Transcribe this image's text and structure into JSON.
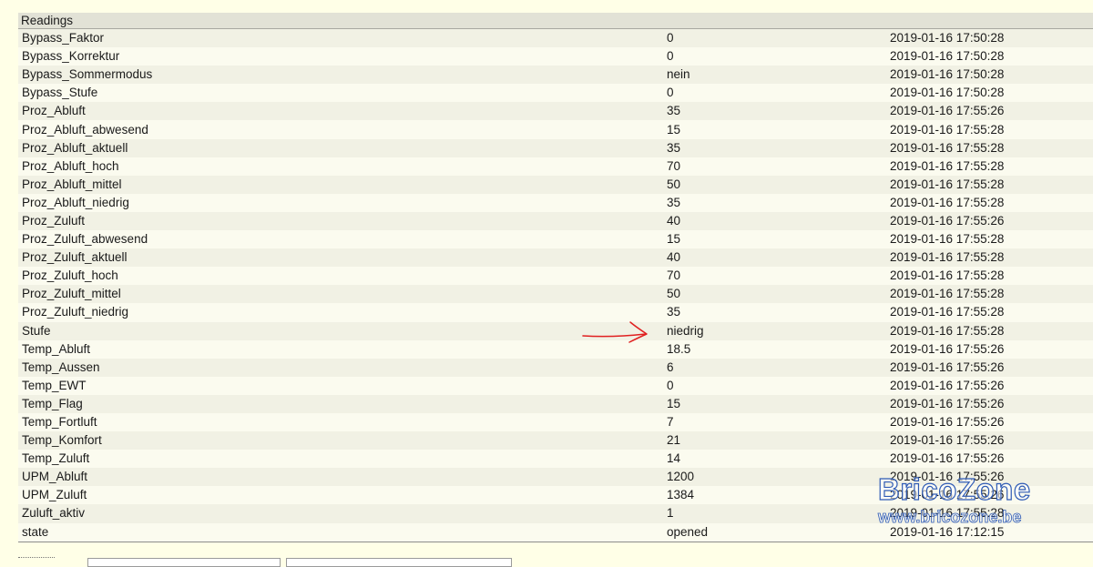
{
  "section": {
    "title": "Readings"
  },
  "readings": [
    {
      "name": "Bypass_Faktor",
      "value": "0",
      "timestamp": "2019-01-16 17:50:28"
    },
    {
      "name": "Bypass_Korrektur",
      "value": "0",
      "timestamp": "2019-01-16 17:50:28"
    },
    {
      "name": "Bypass_Sommermodus",
      "value": "nein",
      "timestamp": "2019-01-16 17:50:28"
    },
    {
      "name": "Bypass_Stufe",
      "value": "0",
      "timestamp": "2019-01-16 17:50:28"
    },
    {
      "name": "Proz_Abluft",
      "value": "35",
      "timestamp": "2019-01-16 17:55:26"
    },
    {
      "name": "Proz_Abluft_abwesend",
      "value": "15",
      "timestamp": "2019-01-16 17:55:28"
    },
    {
      "name": "Proz_Abluft_aktuell",
      "value": "35",
      "timestamp": "2019-01-16 17:55:28"
    },
    {
      "name": "Proz_Abluft_hoch",
      "value": "70",
      "timestamp": "2019-01-16 17:55:28"
    },
    {
      "name": "Proz_Abluft_mittel",
      "value": "50",
      "timestamp": "2019-01-16 17:55:28"
    },
    {
      "name": "Proz_Abluft_niedrig",
      "value": "35",
      "timestamp": "2019-01-16 17:55:28"
    },
    {
      "name": "Proz_Zuluft",
      "value": "40",
      "timestamp": "2019-01-16 17:55:26"
    },
    {
      "name": "Proz_Zuluft_abwesend",
      "value": "15",
      "timestamp": "2019-01-16 17:55:28"
    },
    {
      "name": "Proz_Zuluft_aktuell",
      "value": "40",
      "timestamp": "2019-01-16 17:55:28"
    },
    {
      "name": "Proz_Zuluft_hoch",
      "value": "70",
      "timestamp": "2019-01-16 17:55:28"
    },
    {
      "name": "Proz_Zuluft_mittel",
      "value": "50",
      "timestamp": "2019-01-16 17:55:28"
    },
    {
      "name": "Proz_Zuluft_niedrig",
      "value": "35",
      "timestamp": "2019-01-16 17:55:28"
    },
    {
      "name": "Stufe",
      "value": "niedrig",
      "timestamp": "2019-01-16 17:55:28"
    },
    {
      "name": "Temp_Abluft",
      "value": "18.5",
      "timestamp": "2019-01-16 17:55:26"
    },
    {
      "name": "Temp_Aussen",
      "value": "6",
      "timestamp": "2019-01-16 17:55:26"
    },
    {
      "name": "Temp_EWT",
      "value": "0",
      "timestamp": "2019-01-16 17:55:26"
    },
    {
      "name": "Temp_Flag",
      "value": "15",
      "timestamp": "2019-01-16 17:55:26"
    },
    {
      "name": "Temp_Fortluft",
      "value": "7",
      "timestamp": "2019-01-16 17:55:26"
    },
    {
      "name": "Temp_Komfort",
      "value": "21",
      "timestamp": "2019-01-16 17:55:26"
    },
    {
      "name": "Temp_Zuluft",
      "value": "14",
      "timestamp": "2019-01-16 17:55:26"
    },
    {
      "name": "UPM_Abluft",
      "value": "1200",
      "timestamp": "2019-01-16 17:55:26"
    },
    {
      "name": "UPM_Zuluft",
      "value": "1384",
      "timestamp": "2019-01-16 17:55:26"
    },
    {
      "name": "Zuluft_aktiv",
      "value": "1",
      "timestamp": "2019-01-16 17:55:28"
    },
    {
      "name": "state",
      "value": "opened",
      "timestamp": "2019-01-16 17:12:15"
    }
  ],
  "watermark": {
    "brand": "BricoZone",
    "url": "www.bricozone.be"
  },
  "colors": {
    "page_background": "#ffffe7",
    "row_odd": "#f1f1e4",
    "row_even": "#fbfbef",
    "annotation_arrow": "#e02020",
    "watermark": "#2f5bb5"
  },
  "icons": {
    "annotation": "hand-drawn-red-arrow-icon"
  }
}
